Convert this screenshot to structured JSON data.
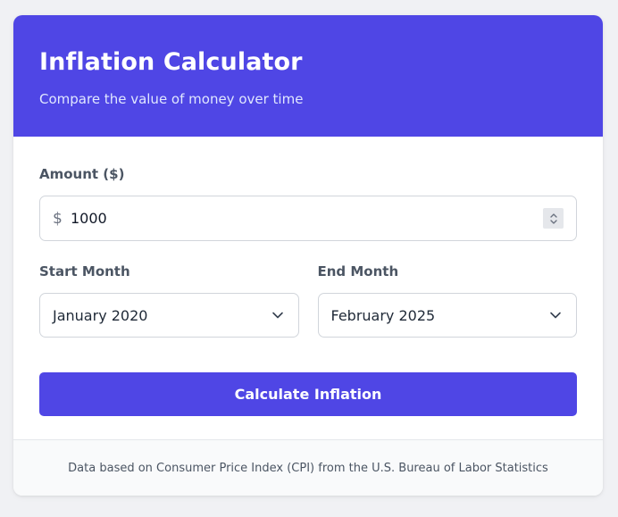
{
  "header": {
    "title": "Inflation Calculator",
    "subtitle": "Compare the value of money over time"
  },
  "amount": {
    "label": "Amount ($)",
    "currency_symbol": "$",
    "value": "1000"
  },
  "start_month": {
    "label": "Start Month",
    "selected": "January 2020"
  },
  "end_month": {
    "label": "End Month",
    "selected": "February 2025"
  },
  "calculate_button": {
    "label": "Calculate Inflation"
  },
  "footer": {
    "text": "Data based on Consumer Price Index (CPI) from the U.S. Bureau of Labor Statistics"
  },
  "colors": {
    "accent": "#4f46e5",
    "background": "#f0f1f4"
  },
  "icons": {
    "spinner": "number-spinner-icon",
    "select_arrow": "chevron-down-icon"
  }
}
